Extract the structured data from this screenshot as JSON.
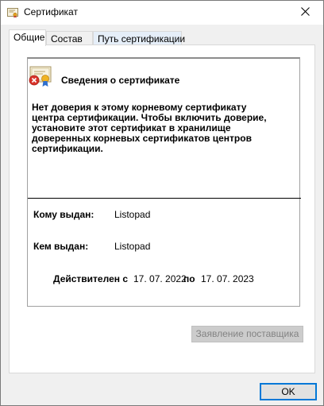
{
  "window": {
    "title": "Сертификат"
  },
  "tabs": [
    {
      "label": "Общие"
    },
    {
      "label": "Состав"
    },
    {
      "label": "Путь сертификации"
    }
  ],
  "info": {
    "title": "Сведения о сертификате",
    "warning": "Нет доверия к этому корневому сертификату центра сертификации. Чтобы включить  доверие, установите этот сертификат в хранилище доверенных корневых сертификатов центров сертификации.",
    "issued_to_label": "Кому выдан:",
    "issued_to_value": "Listopad",
    "issued_by_label": "Кем выдан:",
    "issued_by_value": "Listopad",
    "valid_from_label": "Действителен с",
    "valid_from_value": "17. 07. 2022",
    "valid_to_label": "по",
    "valid_to_value": "17. 07. 2023"
  },
  "buttons": {
    "issuer_statement": "Заявление поставщика",
    "ok": "OK"
  },
  "icons": {
    "title": "certificate-icon",
    "close": "close-icon",
    "cert_untrusted": "certificate-untrusted-icon"
  }
}
